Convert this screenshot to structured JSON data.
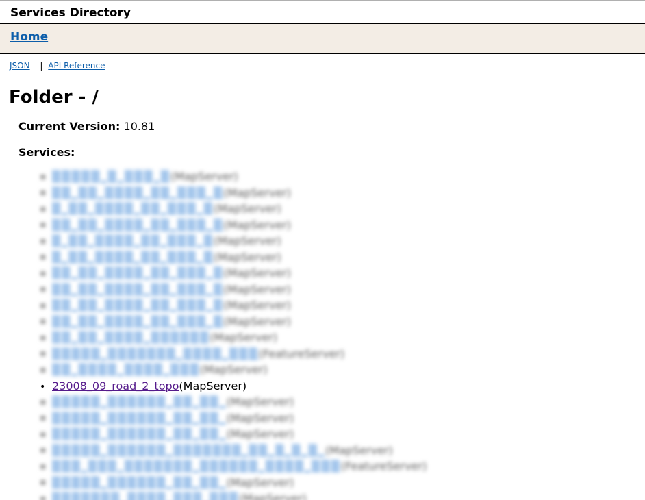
{
  "header": {
    "title": "Services Directory"
  },
  "nav": {
    "home_label": "Home"
  },
  "links": {
    "json_label": "JSON",
    "separator": "|",
    "api_label": "API Reference"
  },
  "folder": {
    "heading": "Folder - /",
    "version_label": "Current Version:",
    "version_value": "10.81",
    "services_label": "Services:"
  },
  "services": [
    {
      "name": "▒▒▒▒▒_▒_▒▒▒_▒",
      "type": "(MapServer)",
      "blurred": true
    },
    {
      "name": "▒▒_▒▒_▒▒▒▒_▒▒_▒▒▒_▒",
      "type": "(MapServer)",
      "blurred": true
    },
    {
      "name": "▒_▒▒_▒▒▒▒_▒▒_▒▒▒_▒",
      "type": "(MapServer)",
      "blurred": true
    },
    {
      "name": "▒▒_▒▒_▒▒▒▒_▒▒_▒▒▒_▒",
      "type": "(MapServer)",
      "blurred": true
    },
    {
      "name": "▒_▒▒_▒▒▒▒_▒▒_▒▒▒_▒",
      "type": "(MapServer)",
      "blurred": true
    },
    {
      "name": "▒_▒▒_▒▒▒▒_▒▒_▒▒▒_▒",
      "type": "(MapServer)",
      "blurred": true
    },
    {
      "name": "▒▒_▒▒_▒▒▒▒_▒▒_▒▒▒_▒",
      "type": "(MapServer)",
      "blurred": true
    },
    {
      "name": "▒▒_▒▒_▒▒▒▒_▒▒_▒▒▒_▒",
      "type": "(MapServer)",
      "blurred": true
    },
    {
      "name": "▒▒_▒▒_▒▒▒▒_▒▒_▒▒▒_▒",
      "type": "(MapServer)",
      "blurred": true
    },
    {
      "name": "▒▒_▒▒_▒▒▒▒_▒▒_▒▒▒_▒",
      "type": "(MapServer)",
      "blurred": true
    },
    {
      "name": "▒▒_▒▒_▒▒▒▒_▒▒▒▒▒▒",
      "type": "(MapServer)",
      "blurred": true
    },
    {
      "name": "▒▒▒▒▒_▒▒▒▒▒▒▒_▒▒▒▒_▒▒▒",
      "type": "(FeatureServer)",
      "blurred": true
    },
    {
      "name": "▒▒_▒▒▒▒_▒▒▒▒_▒▒▒",
      "type": "(MapServer)",
      "blurred": true
    },
    {
      "name": "23008_09_road_2_topo",
      "type": "(MapServer)",
      "blurred": false
    },
    {
      "name": "▒▒▒▒▒_▒▒▒▒▒▒_▒▒_▒▒_",
      "type": "(MapServer)",
      "blurred": true
    },
    {
      "name": "▒▒▒▒▒_▒▒▒▒▒▒_▒▒_▒▒_",
      "type": "(MapServer)",
      "blurred": true
    },
    {
      "name": "▒▒▒▒▒_▒▒▒▒▒▒_▒▒_▒▒_",
      "type": "(MapServer)",
      "blurred": true
    },
    {
      "name": "▒▒▒▒▒_▒▒▒▒▒▒_▒▒▒▒▒▒▒_▒▒_▒_▒_▒_",
      "type": "(MapServer)",
      "blurred": true
    },
    {
      "name": "▒▒▒_▒▒▒_▒▒▒▒▒▒▒_▒▒▒▒▒▒_▒▒▒▒_▒▒▒",
      "type": "(FeatureServer)",
      "blurred": true
    },
    {
      "name": "▒▒▒▒▒_▒▒▒▒▒▒_▒▒_▒▒_",
      "type": "(MapServer)",
      "blurred": true
    },
    {
      "name": "▒▒▒▒▒▒▒_▒▒▒▒_▒▒▒_▒▒▒",
      "type": "(MapServer)",
      "blurred": true
    }
  ]
}
